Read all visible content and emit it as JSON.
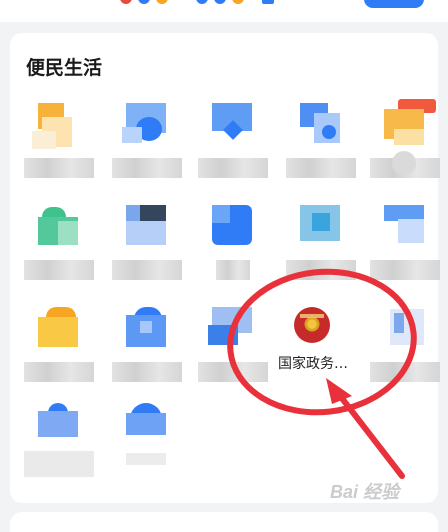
{
  "section": {
    "title": "便民生活"
  },
  "gov_service": {
    "label": "国家政务…"
  },
  "colors": {
    "accent_blue": "#2f7cf6",
    "annotation_red": "#e8313a",
    "emblem_red": "#c62a2a"
  },
  "watermark": {
    "text": "Bai 经验"
  },
  "icons": [
    "gov-emblem-icon"
  ]
}
